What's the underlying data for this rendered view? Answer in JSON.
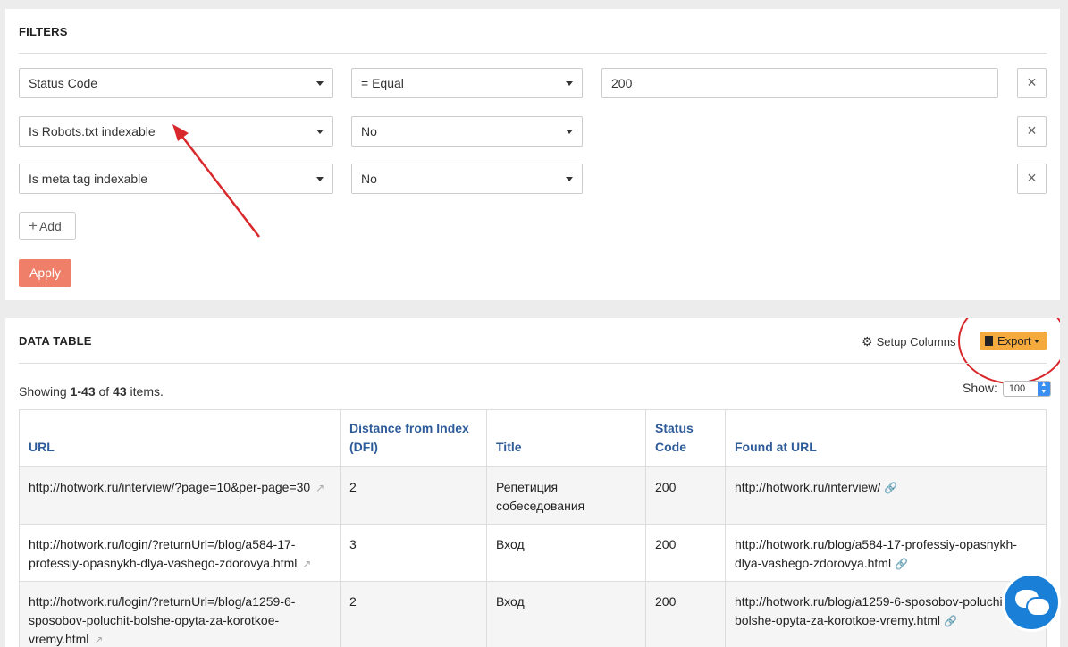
{
  "filters": {
    "title": "FILTERS",
    "rows": [
      {
        "field": "Status Code",
        "operator": "= Equal",
        "value": "200"
      },
      {
        "field": "Is Robots.txt indexable",
        "operator": "No"
      },
      {
        "field": "Is meta tag indexable",
        "operator": "No"
      }
    ],
    "remove_glyph": "×",
    "add_label": "Add",
    "apply_label": "Apply"
  },
  "data_table": {
    "title": "DATA TABLE",
    "setup_columns_label": "Setup Columns",
    "export_label": "Export",
    "summary": {
      "prefix": "Showing ",
      "range": "1-43",
      "middle": " of ",
      "total": "43",
      "suffix": " items."
    },
    "show_label": "Show:",
    "show_value": "100",
    "columns": [
      "URL",
      "Distance from Index (DFI)",
      "Title",
      "Status Code",
      "Found at URL"
    ],
    "rows": [
      {
        "url": "http://hotwork.ru/interview/?page=10&per-page=30",
        "dfi": "2",
        "title": "Репетиция собеседования",
        "status": "200",
        "found": "http://hotwork.ru/interview/"
      },
      {
        "url": "http://hotwork.ru/login/?returnUrl=/blog/a584-17-professiy-opasnykh-dlya-vashego-zdorovya.html",
        "dfi": "3",
        "title": "Вход",
        "status": "200",
        "found": "http://hotwork.ru/blog/a584-17-professiy-opasnykh-dlya-vashego-zdorovya.html"
      },
      {
        "url": "http://hotwork.ru/login/?returnUrl=/blog/a1259-6-sposobov-poluchit-bolshe-opyta-za-korotkoe-vremy.html",
        "dfi": "2",
        "title": "Вход",
        "status": "200",
        "found": "http://hotwork.ru/blog/a1259-6-sposobov-poluchit-bolshe-opyta-za-korotkoe-vremy.html"
      }
    ]
  },
  "colors": {
    "apply": "#ef7f68",
    "export": "#f4aa3d",
    "header_link": "#2e5c9a",
    "annotation": "#d9282c",
    "chat": "#1a7fd6"
  },
  "icons": {
    "gear": "gear-icon",
    "document": "document-icon",
    "external_link": "external-link-icon",
    "link": "link-icon",
    "chat": "chat-icon"
  }
}
